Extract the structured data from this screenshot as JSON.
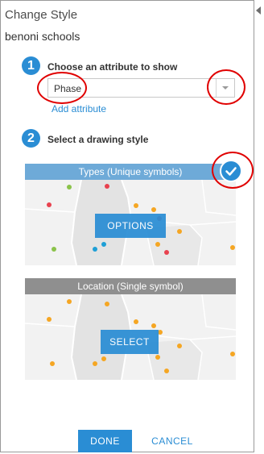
{
  "panel": {
    "title": "Change Style",
    "layer_name": "benoni schools"
  },
  "step1": {
    "number": "1",
    "label": "Choose an attribute to show",
    "attribute_value": "Phase",
    "add_attribute_link": "Add attribute"
  },
  "step2": {
    "number": "2",
    "label": "Select a drawing style"
  },
  "styles": {
    "types": {
      "header": "Types (Unique symbols)",
      "button": "OPTIONS",
      "selected": true
    },
    "location": {
      "header": "Location (Single symbol)",
      "button": "SELECT",
      "selected": false
    }
  },
  "footer": {
    "done_label": "DONE",
    "cancel_label": "CANCEL"
  },
  "icons": {
    "collapse": "collapse-arrow-icon",
    "dropdown": "chevron-down-icon",
    "check": "checkmark-icon"
  },
  "colors": {
    "accent": "#2a8dd4",
    "types_header": "#6eaad8",
    "location_header": "#8f8f8f",
    "annotation": "#e00000",
    "dot_orange": "#f5a623",
    "dot_red": "#e8424f",
    "dot_green": "#8bc34a",
    "dot_blue": "#1e9fd6"
  }
}
